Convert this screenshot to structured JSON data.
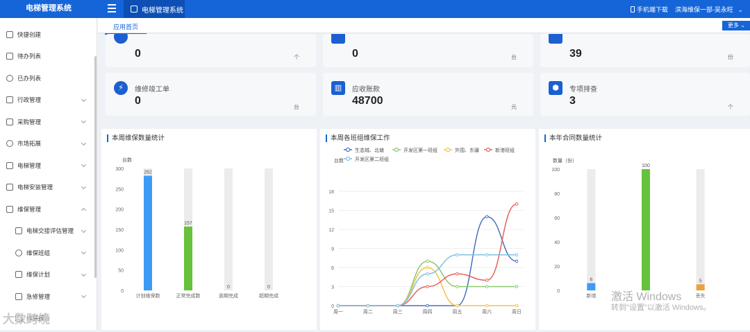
{
  "header": {
    "logo": "电梯管理系统",
    "active_tab": "电梯管理系统",
    "phone_download": "手机端下载",
    "user": "滨海维保一部-吴永旺",
    "colors": {
      "primary": "#1565d8",
      "accent": "#1c5fd1"
    }
  },
  "tabs": {
    "home": "应用首页",
    "more": "更多"
  },
  "sidebar": {
    "items": [
      {
        "label": "快捷创建",
        "icon": "file-plus-icon"
      },
      {
        "label": "待办列表",
        "icon": "file-icon"
      },
      {
        "label": "已办列表",
        "icon": "gear-icon"
      },
      {
        "label": "行政管理",
        "icon": "monitor-icon"
      },
      {
        "label": "采购管理",
        "icon": "cart-icon"
      },
      {
        "label": "市场拓展",
        "icon": "globe-icon"
      },
      {
        "label": "电梯管理",
        "icon": "elevator-icon"
      },
      {
        "label": "电梯安装管理",
        "icon": "wrench-icon"
      },
      {
        "label": "维保管理",
        "icon": "grid-icon"
      },
      {
        "label": "电梯交接评估管理",
        "icon": "doc-edit-icon"
      },
      {
        "label": "维保班组",
        "icon": "team-icon"
      },
      {
        "label": "维保计划",
        "icon": "calendar-icon"
      },
      {
        "label": "急修管理",
        "icon": "alert-icon"
      },
      {
        "label": "维保报告",
        "icon": "report-icon"
      }
    ]
  },
  "stats": [
    {
      "label": "维修竣工单",
      "value": "0",
      "unit": "台",
      "icon": "bolt-icon"
    },
    {
      "label": "应收账款",
      "value": "48700",
      "unit": "元",
      "icon": "columns-icon"
    },
    {
      "label": "专项排查",
      "value": "3",
      "unit": "个",
      "icon": "inspect-icon"
    }
  ],
  "stats_top": [
    {
      "value": "0",
      "unit": "个"
    },
    {
      "value": "0",
      "unit": "台"
    },
    {
      "value": "39",
      "unit": "份"
    }
  ],
  "panels": {
    "p1_title": "本周维保数量统计",
    "p2_title": "本周各班组维保工作",
    "p3_title": "本年合同数量统计"
  },
  "chart_data": [
    {
      "type": "bar",
      "ylabel": "台数",
      "ylim": [
        0,
        300
      ],
      "yticks": [
        "0",
        "50",
        "100",
        "150",
        "200",
        "250",
        "300"
      ],
      "categories": [
        "计划维保数",
        "正常完成数",
        "逾期完成",
        "超期完成"
      ],
      "values": [
        282,
        157,
        0,
        0
      ],
      "colors": [
        "#3d9bf5",
        "#66c23a",
        "#3d9bf5",
        "#3d9bf5"
      ]
    },
    {
      "type": "line",
      "ylabel": "台数",
      "ylim": [
        0,
        18
      ],
      "yticks": [
        "0",
        "3",
        "6",
        "9",
        "12",
        "15",
        "18"
      ],
      "x": [
        "周一",
        "周二",
        "周三",
        "周四",
        "周五",
        "周六",
        "周日"
      ],
      "series": [
        {
          "name": "生态城、北塘",
          "color": "#4a6fc0",
          "values": [
            0,
            0,
            0,
            0,
            0,
            14,
            7
          ]
        },
        {
          "name": "开发区第一班组",
          "color": "#8cc86a",
          "values": [
            0,
            0,
            0,
            7,
            3,
            3,
            3
          ]
        },
        {
          "name": "外围、东疆",
          "color": "#f3c24a",
          "values": [
            0,
            0,
            0,
            6,
            0,
            0,
            0
          ]
        },
        {
          "name": "新港班组",
          "color": "#e8615b",
          "values": [
            0,
            0,
            0,
            3,
            5,
            4,
            16
          ]
        },
        {
          "name": "开发区第二班组",
          "color": "#7ec0e4",
          "values": [
            0,
            0,
            0,
            5,
            8,
            8,
            8
          ]
        }
      ]
    },
    {
      "type": "bar",
      "ylabel": "数量（份）",
      "ylim": [
        0,
        100
      ],
      "yticks": [
        "0",
        "20",
        "40",
        "60",
        "80",
        "100"
      ],
      "categories": [
        "新增",
        "",
        "丢失"
      ],
      "values": [
        6,
        100,
        5
      ],
      "colors": [
        "#3d9bf5",
        "#66c23a",
        "#e9a23b"
      ]
    }
  ],
  "watermark": {
    "line1": "激活 Windows",
    "line2": "转到\"设置\"以激活 Windows。",
    "brand": "大数跨境"
  }
}
